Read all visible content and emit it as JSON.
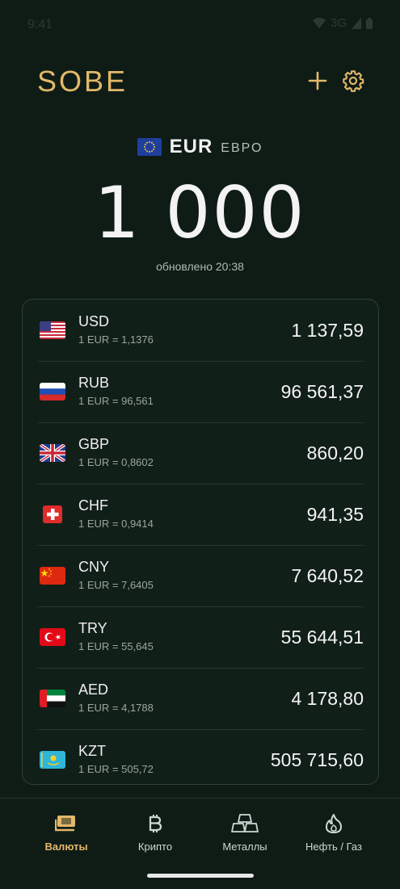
{
  "status_bar": {
    "time": "9:41",
    "network": "3G"
  },
  "app": {
    "logo": "SOBE"
  },
  "base": {
    "flag": "flag-eu",
    "code": "EUR",
    "name": "ЕВРО"
  },
  "amount": "1 000",
  "updated": "обновлено 20:38",
  "rates": [
    {
      "code": "USD",
      "sub": "1 EUR = 1,1376",
      "value": "1 137,59",
      "flag": "flag-us"
    },
    {
      "code": "RUB",
      "sub": "1 EUR = 96,561",
      "value": "96 561,37",
      "flag": "flag-ru"
    },
    {
      "code": "GBP",
      "sub": "1 EUR = 0,8602",
      "value": "860,20",
      "flag": "flag-gb"
    },
    {
      "code": "CHF",
      "sub": "1 EUR = 0,9414",
      "value": "941,35",
      "flag": "flag-ch"
    },
    {
      "code": "CNY",
      "sub": "1 EUR = 7,6405",
      "value": "7 640,52",
      "flag": "flag-cn"
    },
    {
      "code": "TRY",
      "sub": "1 EUR = 55,645",
      "value": "55 644,51",
      "flag": "flag-tr"
    },
    {
      "code": "AED",
      "sub": "1 EUR = 4,1788",
      "value": "4 178,80",
      "flag": "flag-ae"
    },
    {
      "code": "KZT",
      "sub": "1 EUR = 505,72",
      "value": "505 715,60",
      "flag": "flag-kz"
    }
  ],
  "nav": [
    {
      "label": "Валюты",
      "icon": "cash-icon",
      "active": true
    },
    {
      "label": "Крипто",
      "icon": "bitcoin-icon",
      "active": false
    },
    {
      "label": "Металлы",
      "icon": "gold-bars-icon",
      "active": false
    },
    {
      "label": "Нефть / Газ",
      "icon": "flame-icon",
      "active": false
    }
  ],
  "colors": {
    "accent": "#e3b86a",
    "background": "#0f1c16",
    "card": "#111f19"
  }
}
